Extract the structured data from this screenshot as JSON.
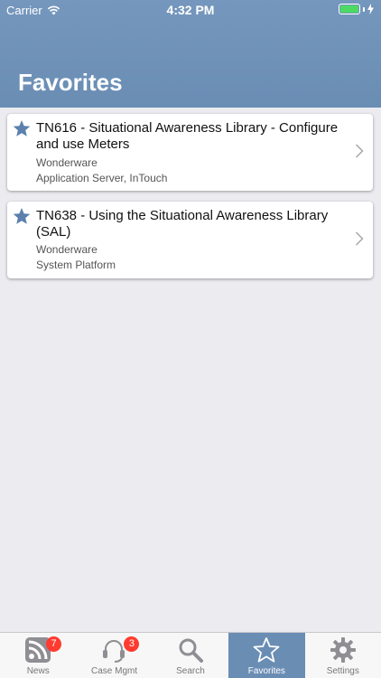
{
  "status_bar": {
    "carrier": "Carrier",
    "time": "4:32 PM"
  },
  "header": {
    "title": "Favorites"
  },
  "favorites": [
    {
      "title": "TN616 - Situational Awareness Library - Configure and use Meters",
      "vendor": "Wonderware",
      "products": "Application Server, InTouch"
    },
    {
      "title": "TN638 - Using the Situational Awareness Library (SAL)",
      "vendor": "Wonderware",
      "products": "System Platform"
    }
  ],
  "tabs": [
    {
      "label": "News",
      "icon": "rss-icon",
      "badge": "7"
    },
    {
      "label": "Case Mgmt",
      "icon": "headset-icon",
      "badge": "3"
    },
    {
      "label": "Search",
      "icon": "search-icon"
    },
    {
      "label": "Favorites",
      "icon": "star-icon",
      "active": true
    },
    {
      "label": "Settings",
      "icon": "gear-icon"
    }
  ],
  "colors": {
    "header": "#6a8db4",
    "accent_star": "#5b80ad",
    "badge": "#ff3b30",
    "battery": "#4cd964"
  }
}
